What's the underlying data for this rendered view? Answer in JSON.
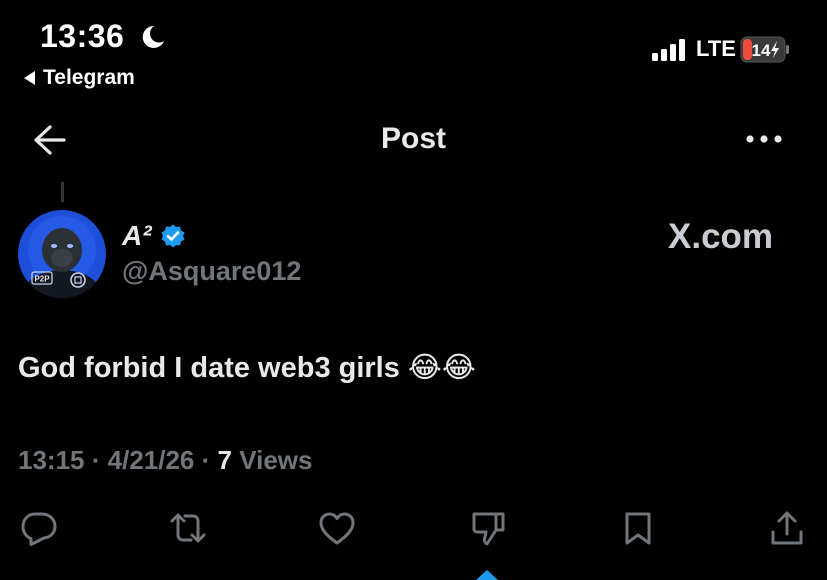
{
  "status_bar": {
    "time": "13:36",
    "back_app": "Telegram",
    "network": "LTE",
    "battery": "14"
  },
  "header": {
    "title": "Post"
  },
  "author": {
    "display_name": "A²",
    "handle": "@Asquare012",
    "avatar_chest_text": "P2P"
  },
  "watermark": "X.com",
  "post": {
    "text": "God forbid I date web3 girls 😂😂",
    "time": "13:15",
    "date": "4/21/26",
    "views_count": "7",
    "views_label": "Views",
    "separator": "·"
  },
  "colors": {
    "background": "#000000",
    "text": "#e7e9ea",
    "muted": "#71767b",
    "verified": "#1d9bf0",
    "battery_low": "#eb4d3d"
  },
  "icons": {
    "reply": "reply-icon",
    "repost": "repost-icon",
    "like": "heart-icon",
    "dislike": "thumbs-down-icon",
    "bookmark": "bookmark-icon",
    "share": "share-icon"
  }
}
